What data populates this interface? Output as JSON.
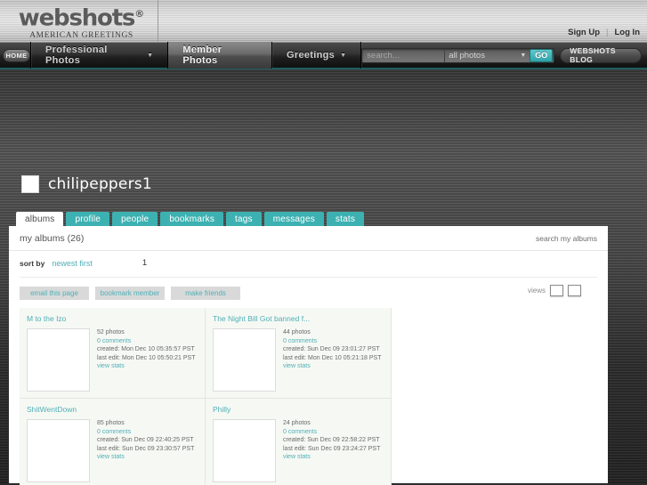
{
  "brand": {
    "logo_main": "webshots",
    "logo_reg": "®",
    "logo_sub": "AMERICAN GREETINGS",
    "sign_up": "Sign Up",
    "divider": "|",
    "log_in": "Log In"
  },
  "nav": {
    "home": "HOME",
    "tabs": [
      {
        "label": "Professional Photos",
        "caret": "▼",
        "active": false
      },
      {
        "label": "Member Photos",
        "caret": "",
        "active": true
      },
      {
        "label": "Greetings",
        "caret": "▼",
        "active": false
      }
    ],
    "search_placeholder": "search...",
    "search_value": "",
    "search_scope": "all photos",
    "search_scope_caret": "▼",
    "go": "GO",
    "blog": "WEBSHOTS BLOG",
    "accent_teal": "#2fa3a8"
  },
  "member": {
    "username": "chilipeppers1",
    "tabs": [
      {
        "label": "albums",
        "active": true
      },
      {
        "label": "profile",
        "active": false
      },
      {
        "label": "people",
        "active": false
      },
      {
        "label": "bookmarks",
        "active": false
      },
      {
        "label": "tags",
        "active": false
      },
      {
        "label": "messages",
        "active": false
      },
      {
        "label": "stats",
        "active": false
      }
    ]
  },
  "panel": {
    "title": "my albums (26)",
    "search_link": "search my albums",
    "sort_label": "sort by",
    "sort_value": "newest first",
    "page_number": "1",
    "actions": [
      {
        "label": "email this page"
      },
      {
        "label": "bookmark member"
      },
      {
        "label": "make friends"
      }
    ],
    "views_label": "views"
  },
  "albums": [
    {
      "title": "M to the Izo",
      "photos": "52 photos",
      "comments": "0 comments",
      "created": "created: Mon Dec 10 05:35:57 PST",
      "last_edit": "last edit: Mon Dec 10 05:50:21 PST",
      "view_stats": "view stats"
    },
    {
      "title": "The Night Bill Got banned f...",
      "photos": "44 photos",
      "comments": "0 comments",
      "created": "created: Sun Dec 09 23:01:27 PST",
      "last_edit": "last edit: Mon Dec 10 05:21:18 PST",
      "view_stats": "view stats"
    },
    {
      "title": "ShitWentDown",
      "photos": "85 photos",
      "comments": "0 comments",
      "created": "created: Sun Dec 09 22:40:25 PST",
      "last_edit": "last edit: Sun Dec 09 23:30:57 PST",
      "view_stats": "view stats"
    },
    {
      "title": "Philly",
      "photos": "24 photos",
      "comments": "0 comments",
      "created": "created: Sun Dec 09 22:58:22 PST",
      "last_edit": "last edit: Sun Dec 09 23:24:27 PST",
      "view_stats": "view stats"
    }
  ]
}
